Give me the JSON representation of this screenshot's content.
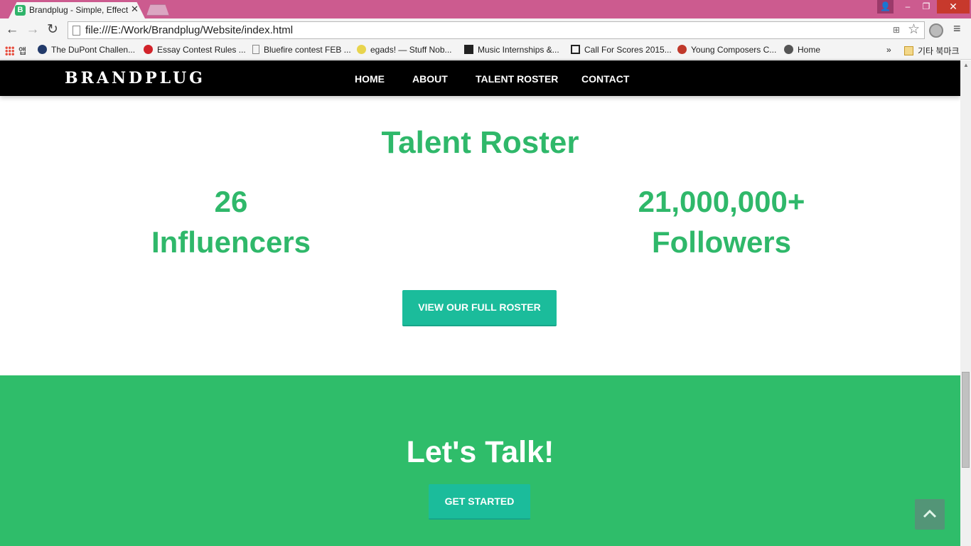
{
  "browser": {
    "tab_title": "Brandplug - Simple, Effect",
    "favicon_letter": "B",
    "url": "file:///E:/Work/Brandplug/Website/index.html",
    "bookmarks": [
      {
        "label": "앱"
      },
      {
        "label": "The DuPont Challen..."
      },
      {
        "label": "Essay Contest Rules ..."
      },
      {
        "label": "Bluefire contest FEB ..."
      },
      {
        "label": "egads! — Stuff Nob..."
      },
      {
        "label": "Music Internships &..."
      },
      {
        "label": "Call For Scores 2015..."
      },
      {
        "label": "Young Composers C..."
      },
      {
        "label": "Home"
      }
    ],
    "bookmarks_overflow": "»",
    "other_bookmarks": "기타 북마크"
  },
  "site": {
    "brand": "BRANDPLUG",
    "nav": [
      "HOME",
      "ABOUT",
      "TALENT ROSTER",
      "CONTACT"
    ],
    "roster": {
      "title": "Talent Roster",
      "stat1_value": "26",
      "stat1_label": "Influencers",
      "stat2_value": "21,000,000+",
      "stat2_label": "Followers",
      "button": "VIEW OUR FULL ROSTER"
    },
    "talk": {
      "title": "Let's Talk!",
      "button": "GET STARTED"
    }
  },
  "colors": {
    "accent_green": "#2fb86a",
    "button_teal": "#1bbc9b",
    "chrome_titlebar": "#cc5b8f"
  }
}
